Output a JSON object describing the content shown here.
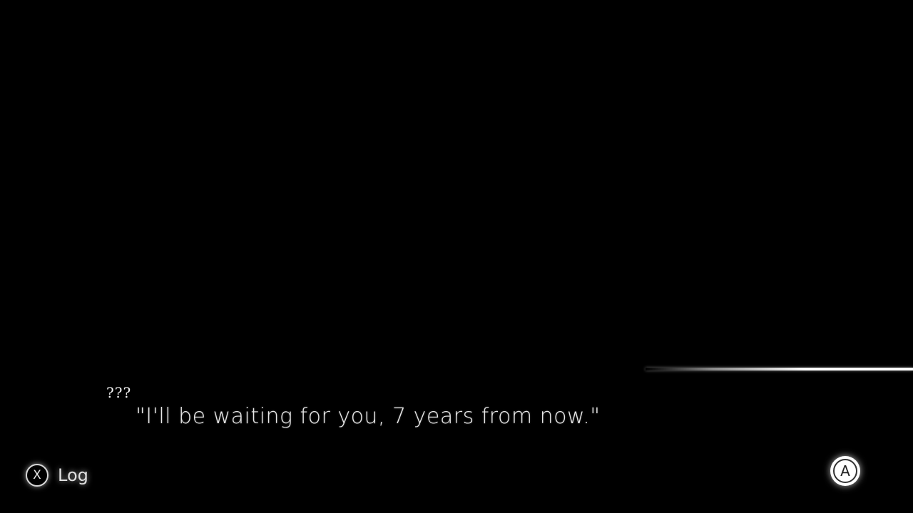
{
  "dialogue": {
    "speaker": "???",
    "text": "\"I'll be waiting for you, 7 years from now.\""
  },
  "controls": {
    "log_button_glyph": "X",
    "log_label": "Log",
    "advance_button_glyph": "A"
  },
  "colors": {
    "background": "#000000",
    "text": "#ffffff"
  },
  "icons": {
    "log": "x-button-icon",
    "advance": "a-button-icon"
  }
}
